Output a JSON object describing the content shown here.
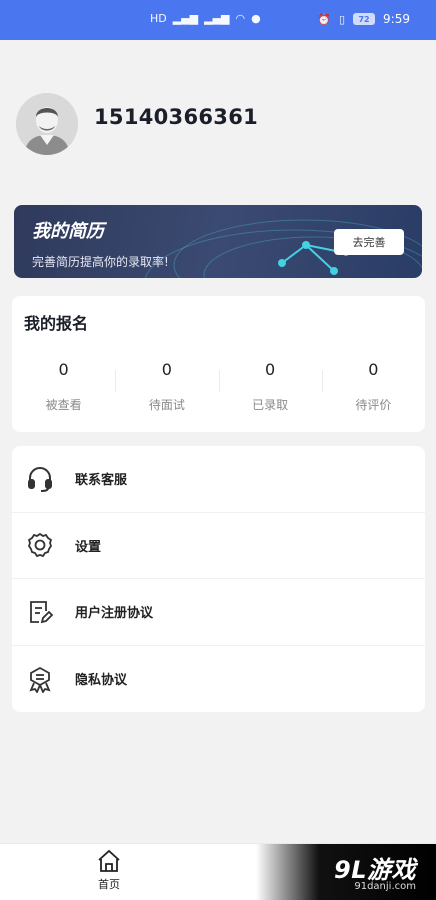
{
  "status_bar": {
    "left_indicators": [
      "HD",
      "5G",
      "4G",
      "WiFi",
      "Q"
    ],
    "battery": "72",
    "time": "9:59",
    "background_color": "#4a76f0"
  },
  "profile": {
    "phone": "15140366361",
    "avatar_icon": "user-avatar"
  },
  "resume": {
    "title": "我的简历",
    "subtitle": "完善简历提高你的录取率!",
    "button": "去完善"
  },
  "signup": {
    "title": "我的报名",
    "stats": [
      {
        "value": "0",
        "label": "被查看"
      },
      {
        "value": "0",
        "label": "待面试"
      },
      {
        "value": "0",
        "label": "已录取"
      },
      {
        "value": "0",
        "label": "待评价"
      }
    ]
  },
  "menu": [
    {
      "label": "联系客服",
      "icon": "headset-icon"
    },
    {
      "label": "设置",
      "icon": "gear-icon"
    },
    {
      "label": "用户注册协议",
      "icon": "document-edit-icon"
    },
    {
      "label": "隐私协议",
      "icon": "privacy-badge-icon"
    }
  ],
  "bottom_nav": {
    "home_label": "首页"
  },
  "watermark": {
    "logo": "9L游戏",
    "url": "91danji.com"
  }
}
